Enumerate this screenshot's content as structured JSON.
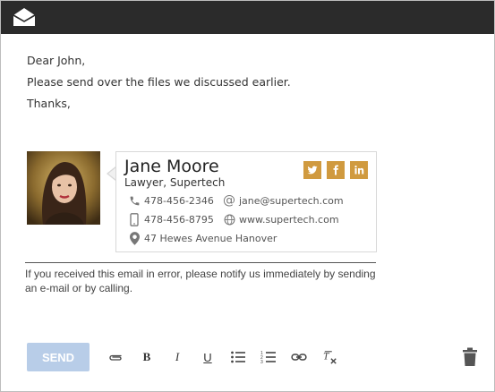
{
  "compose": {
    "greeting": "Dear John,",
    "line1": "Please send over the files we discussed earlier.",
    "closing": "Thanks,"
  },
  "signature": {
    "name": "Jane Moore",
    "title": "Lawyer, Supertech",
    "phone": "478-456-2346",
    "mobile": "478-456-8795",
    "email": "jane@supertech.com",
    "website": "www.supertech.com",
    "address": "47 Hewes Avenue Hanover",
    "accent_color": "#d09a3f",
    "social": [
      "twitter-icon",
      "facebook-icon",
      "linkedin-icon"
    ]
  },
  "disclaimer": "If you received this email in error, please notify us immediately by sending an e-mail or by calling.",
  "toolbar": {
    "send_label": "SEND",
    "icons": [
      "attachment-icon",
      "bold-icon",
      "italic-icon",
      "underline-icon",
      "bulleted-list-icon",
      "numbered-list-icon",
      "link-icon",
      "clear-formatting-icon",
      "trash-icon"
    ]
  }
}
